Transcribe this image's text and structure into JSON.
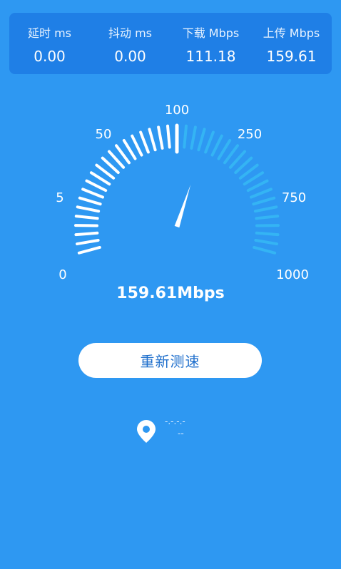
{
  "stats": [
    {
      "label": "延时 ms",
      "value": "0.00"
    },
    {
      "label": "抖动 ms",
      "value": "0.00"
    },
    {
      "label": "下载 Mbps",
      "value": "111.18"
    },
    {
      "label": "上传 Mbps",
      "value": "159.61"
    }
  ],
  "gauge": {
    "scale_labels": [
      "0",
      "5",
      "50",
      "100",
      "250",
      "750",
      "1000"
    ],
    "speed_text": "159.61Mbps",
    "colors": {
      "active": "#34b4f4",
      "inactive": "#ffffff",
      "needle": "#ffffff"
    }
  },
  "button": {
    "label": "重新测速"
  },
  "location": {
    "icon": "location-pin-icon",
    "line1": "-.-.-.-",
    "line2": "--"
  }
}
